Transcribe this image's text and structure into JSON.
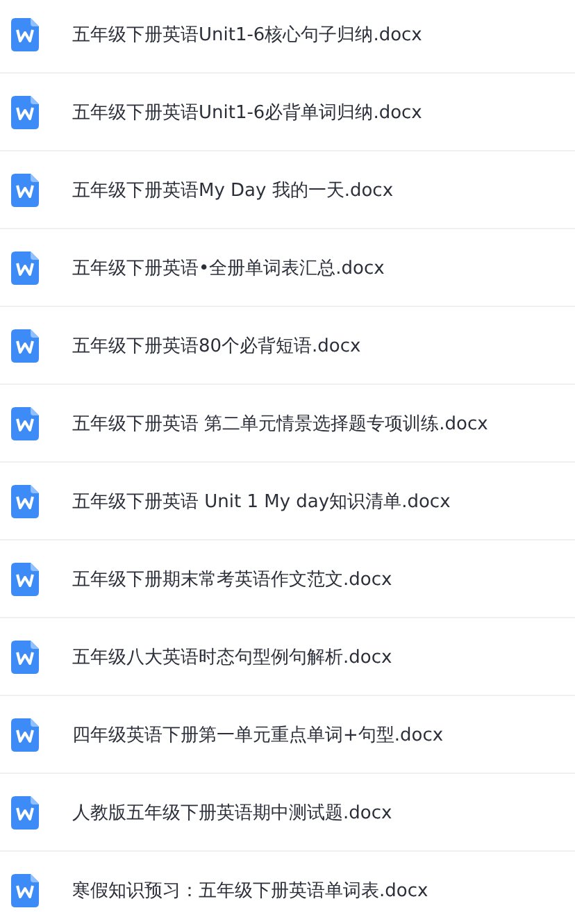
{
  "files": [
    {
      "name": "五年级下册英语Unit1-6核心句子归纳.docx"
    },
    {
      "name": "五年级下册英语Unit1-6必背单词归纳.docx"
    },
    {
      "name": "五年级下册英语My Day 我的一天.docx"
    },
    {
      "name": "五年级下册英语•全册单词表汇总.docx"
    },
    {
      "name": "五年级下册英语80个必背短语.docx"
    },
    {
      "name": "五年级下册英语 第二单元情景选择题专项训练.docx"
    },
    {
      "name": "五年级下册英语 Unit 1 My day知识清单.docx"
    },
    {
      "name": "五年级下册期末常考英语作文范文.docx"
    },
    {
      "name": "五年级八大英语时态句型例句解析.docx"
    },
    {
      "name": "四年级英语下册第一单元重点单词+句型.docx"
    },
    {
      "name": "人教版五年级下册英语期中测试题.docx"
    },
    {
      "name": "寒假知识预习：五年级下册英语单词表.docx"
    }
  ]
}
